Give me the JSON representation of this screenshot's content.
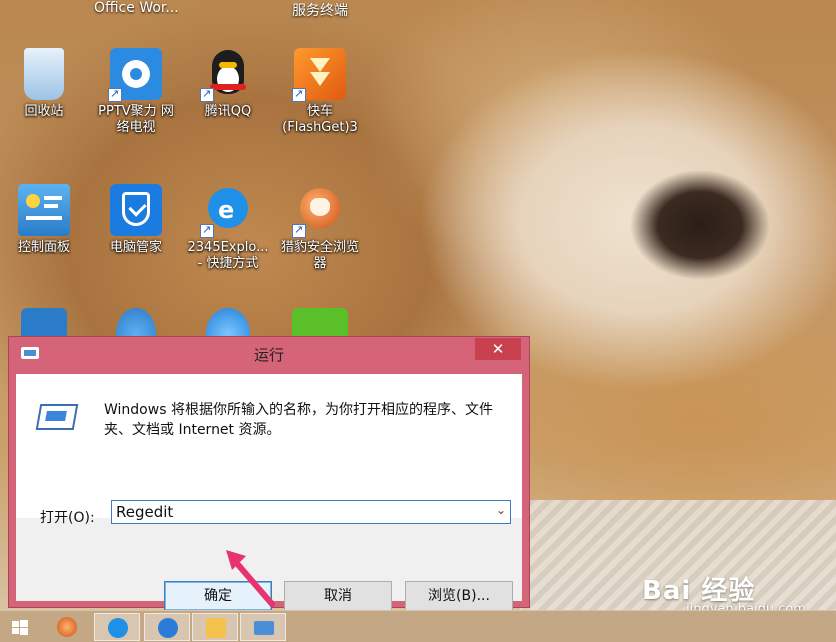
{
  "desktop": {
    "top_labels": [
      "Office Wor...",
      "服务终端"
    ],
    "icons": [
      {
        "label": "回收站",
        "icon": "recycle-bin-icon",
        "color": "#6aa6d8"
      },
      {
        "label": "PPTV聚力 网络电视",
        "icon": "pptv-icon",
        "color": "#2a8be0"
      },
      {
        "label": "腾讯QQ",
        "icon": "qq-penguin-icon",
        "color": "#222222"
      },
      {
        "label": "快车 (FlashGet)3",
        "icon": "flashget-icon",
        "color": "#f07a1a"
      },
      {
        "label": "控制面板",
        "icon": "control-panel-icon",
        "color": "#3a8fd8"
      },
      {
        "label": "电脑管家",
        "icon": "pc-manager-icon",
        "color": "#1a7be0"
      },
      {
        "label": "2345Explo... - 快捷方式",
        "icon": "ie-browser-icon",
        "color": "#1e90e8"
      },
      {
        "label": "猎豹安全浏览器",
        "icon": "liebao-browser-icon",
        "color": "#e0661a"
      }
    ]
  },
  "run_dialog": {
    "title": "运行",
    "close_glyph": "✕",
    "description": "Windows 将根据你所输入的名称，为你打开相应的程序、文件夹、文档或 Internet 资源。",
    "open_label": "打开(O):",
    "open_value": "Regedit",
    "ok_label": "确定",
    "cancel_label": "取消",
    "browse_label": "浏览(B)..."
  },
  "watermark": {
    "logo": "Bai 经验",
    "url": "jingyan.baidu.com"
  },
  "colors": {
    "dialog_frame": "#d66478",
    "close_button": "#c9404f",
    "annotation_arrow": "#e8336d"
  }
}
